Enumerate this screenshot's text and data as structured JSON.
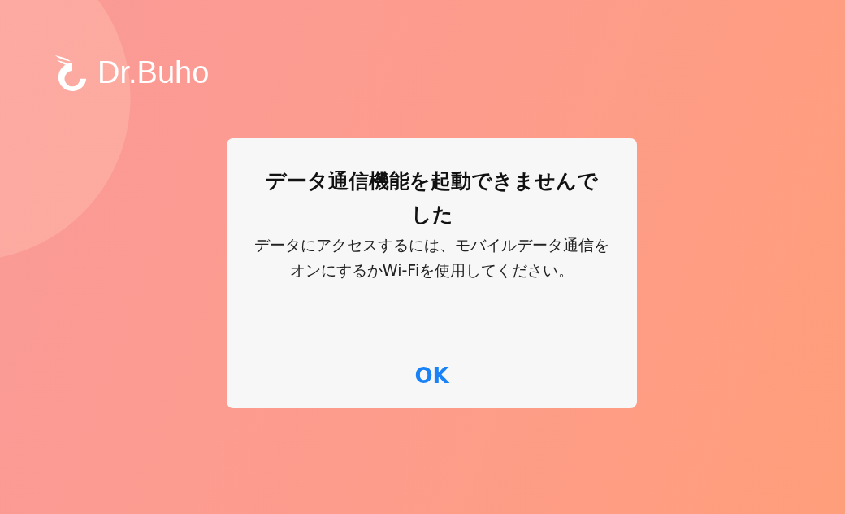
{
  "brand": {
    "name": "Dr.Buho"
  },
  "alert": {
    "title": "データ通信機能を起動できませんでした",
    "message": "データにアクセスするには、モバイルデータ通信をオンにするかWi-Fiを使用してください。",
    "buttons": [
      "OK"
    ]
  }
}
